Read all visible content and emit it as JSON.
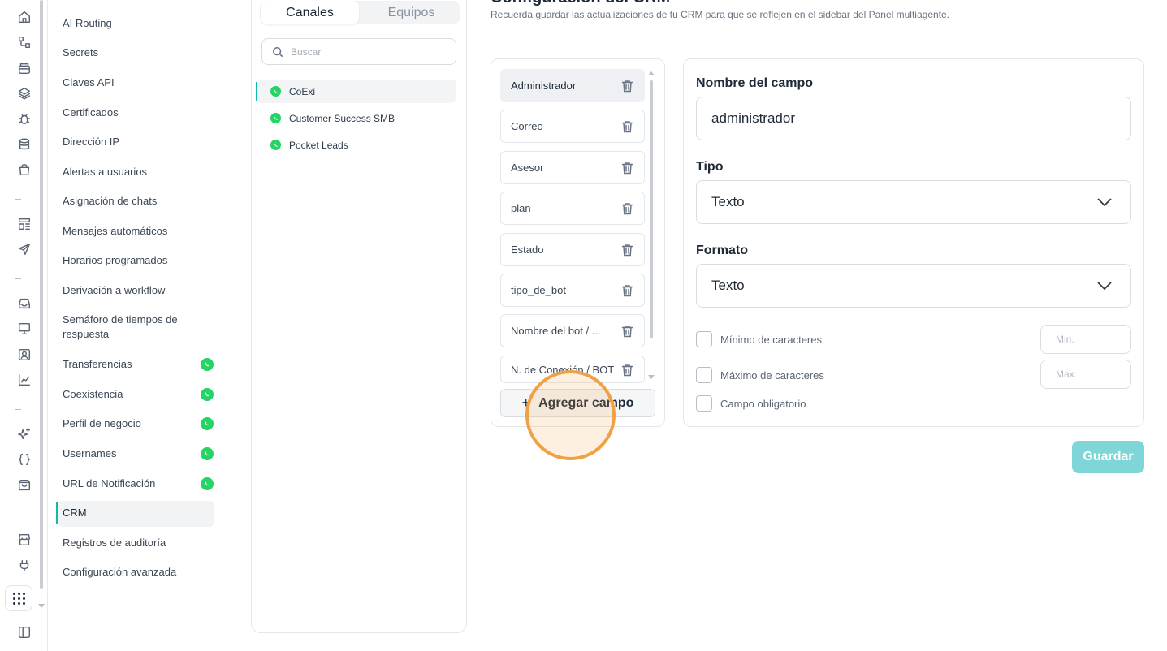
{
  "rail": {
    "icons": [
      "home-icon",
      "workflow-icon",
      "archive-icon",
      "layers-icon",
      "bug-icon",
      "database-icon",
      "bag-icon",
      "layout-icon",
      "send-icon",
      "inbox-icon",
      "monitor-icon",
      "contact-icon",
      "chart-icon",
      "sparkles-icon",
      "braces-icon",
      "package-icon",
      "store-icon",
      "plug-icon"
    ]
  },
  "menu": {
    "items": [
      {
        "label": "AI Routing",
        "wa": false
      },
      {
        "label": "Secrets",
        "wa": false
      },
      {
        "label": "Claves API",
        "wa": false
      },
      {
        "label": "Certificados",
        "wa": false
      },
      {
        "label": "Dirección IP",
        "wa": false
      },
      {
        "label": "Alertas a usuarios",
        "wa": false
      },
      {
        "label": "Asignación de chats",
        "wa": false
      },
      {
        "label": "Mensajes automáticos",
        "wa": false
      },
      {
        "label": "Horarios programados",
        "wa": false
      },
      {
        "label": "Derivación a workflow",
        "wa": false
      },
      {
        "label": "Semáforo de tiempos de respuesta",
        "wa": false
      },
      {
        "label": "Transferencias",
        "wa": true
      },
      {
        "label": "Coexistencia",
        "wa": true
      },
      {
        "label": "Perfil de negocio",
        "wa": true
      },
      {
        "label": "Usernames",
        "wa": true
      },
      {
        "label": "URL de Notificación",
        "wa": true
      },
      {
        "label": "CRM",
        "wa": false,
        "active": true
      },
      {
        "label": "Registros de auditoría",
        "wa": false
      },
      {
        "label": "Configuración avanzada",
        "wa": false
      }
    ]
  },
  "channels": {
    "tabs": [
      "Canales",
      "Equipos"
    ],
    "search_placeholder": "Buscar",
    "list": [
      "CoExi",
      "Customer Success SMB",
      "Pocket Leads"
    ],
    "selected": "CoExi"
  },
  "header": {
    "title": "Configuración del CRM",
    "subtitle": "Recuerda guardar las actualizaciones de tu CRM para que se reflejen en el sidebar del Panel multiagente."
  },
  "fields": {
    "items": [
      "Administrador",
      "Correo",
      "Asesor",
      "plan",
      "Estado",
      "tipo_de_bot",
      "Nombre del bot / ...",
      "N. de Conexión / BOT"
    ],
    "selected": "Administrador",
    "add_label": "Agregar campo"
  },
  "detail": {
    "name_label": "Nombre del campo",
    "name_value": "administrador",
    "type_label": "Tipo",
    "type_value": "Texto",
    "format_label": "Formato",
    "format_value": "Texto",
    "min_label": "Mínimo de caracteres",
    "min_placeholder": "Min.",
    "max_label": "Máximo de caracteres",
    "max_placeholder": "Max.",
    "required_label": "Campo obligatorio"
  },
  "save_label": "Guardar",
  "colors": {
    "accent": "#14b8a6",
    "whatsapp": "#25d366",
    "save_disabled": "#7fd6d9",
    "click_marker": "#f0a045"
  }
}
